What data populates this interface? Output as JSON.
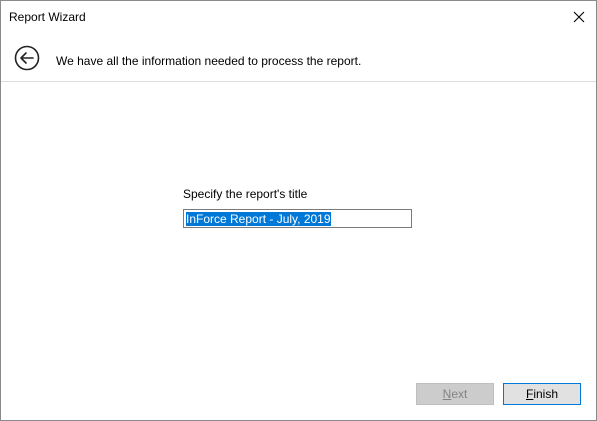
{
  "window": {
    "title": "Report Wizard",
    "close_icon": "close-icon"
  },
  "header": {
    "back_icon": "back-arrow-icon",
    "message": "We have all the information needed to process the report."
  },
  "form": {
    "label": "Specify the report's title",
    "title_value": "InForce Report - July, 2019",
    "title_selected": true
  },
  "buttons": {
    "next": {
      "accel": "N",
      "rest": "ext",
      "enabled": false
    },
    "finish": {
      "accel": "F",
      "rest": "inish",
      "enabled": true
    }
  },
  "colors": {
    "selection": "#0078d7",
    "focus_border": "#0078d7",
    "disabled_text": "#838383"
  }
}
